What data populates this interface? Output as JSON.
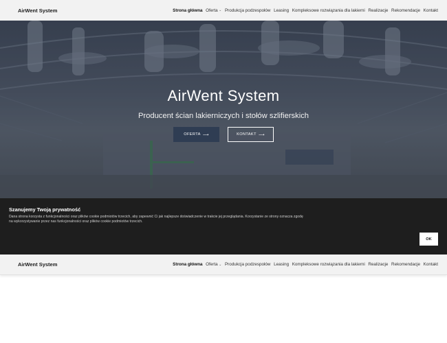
{
  "brand": "AirWent System",
  "nav": {
    "items": [
      {
        "label": "Strona główna",
        "active": true,
        "dropdown": false
      },
      {
        "label": "Oferta",
        "active": false,
        "dropdown": true
      },
      {
        "label": "Produkcja podzespołów",
        "active": false,
        "dropdown": false
      },
      {
        "label": "Leasing",
        "active": false,
        "dropdown": false
      },
      {
        "label": "Kompleksowe rozwiązania dla lakierni",
        "active": false,
        "dropdown": false
      },
      {
        "label": "Realizacje",
        "active": false,
        "dropdown": false
      },
      {
        "label": "Rekomendacje",
        "active": false,
        "dropdown": false
      },
      {
        "label": "Kontakt",
        "active": false,
        "dropdown": false
      }
    ]
  },
  "hero": {
    "title": "AirWent System",
    "subtitle": "Producent ścian lakierniczych i stołów szlifierskich",
    "primary_button": "OFERTA",
    "secondary_button": "KONTAKT",
    "arrow": "⟶"
  },
  "cookie": {
    "title": "Szanujemy Twoją prywatność",
    "text": "Dana strona korzysta z funkcjonalności oraz plików cookie podmiotów trzecich, aby zapewnić Ci jak najlepsze doświadczenie w trakcie jej przeglądania. Korzystanie ze strony oznacza zgodę na wykorzystywanie przez nas funkcjonalności oraz plików cookie podmiotów trzecich.",
    "ok_label": "OK"
  },
  "colors": {
    "nav_bg": "#f2f2f2",
    "primary_button_bg": "#2f3d53",
    "cookie_bg": "#1e1e1e"
  }
}
